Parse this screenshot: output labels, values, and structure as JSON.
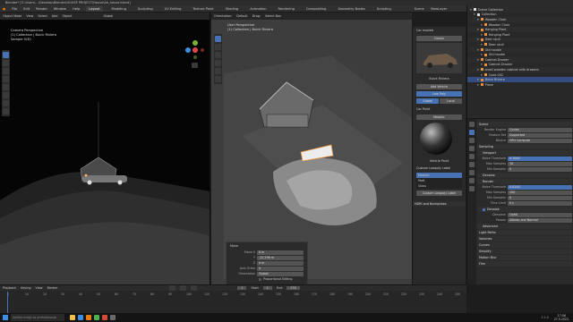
{
  "window": {
    "title": "Blender* [C:\\Users\\...\\Desktop\\Blender\\HOUSE PROJECT\\House\\Ab_house.blend]"
  },
  "menu": {
    "items": [
      "File",
      "Edit",
      "Render",
      "Window",
      "Help"
    ],
    "workspaces": [
      "Layout",
      "Modeling",
      "Sculpting",
      "UV Editing",
      "Texture Paint",
      "Shading",
      "Animation",
      "Rendering",
      "Compositing",
      "Geometry Nodes",
      "Scripting"
    ],
    "active_workspace": "Layout",
    "scene": "Scene",
    "view_layer": "ViewLayer"
  },
  "left_viewport": {
    "header": [
      "Object Mode",
      "View",
      "Select",
      "Add",
      "Object",
      "Global"
    ],
    "overlay_lines": [
      "Camera Perspective",
      "(1) Collection | Buick Riviera",
      "Sample 0/30"
    ]
  },
  "center_viewport": {
    "header": [
      "Orientation:",
      "Default",
      "Drag:",
      "Select Box"
    ],
    "overlay_lines": [
      "User Perspective",
      "(1) Collection | Buick Riviera"
    ]
  },
  "asset_panel": {
    "heading": "Car models",
    "category": "Classic",
    "asset_name": "Buick Riviera",
    "buttons": [
      "Add Vehicle",
      "Low Poly",
      "Car Paint",
      "Custom Lowpoly Label"
    ],
    "toggles": [
      "Global",
      "Local"
    ],
    "paint_label": "Metallic",
    "material_name": "Vehicle Paint",
    "list_header": "Custom Lowpoly Label",
    "list_items": [
      "Metallic",
      "Matt",
      "Gloss"
    ],
    "section": "HDRI and Backplates"
  },
  "redo_panel": {
    "title": "Move",
    "rows": [
      {
        "label": "Move X",
        "value": "0 m"
      },
      {
        "label": "Y",
        "value": "-12.296 m"
      },
      {
        "label": "Z",
        "value": "0 m"
      },
      {
        "label": "Axis Ortho",
        "value": "X"
      },
      {
        "label": "Orientation",
        "value": "Global"
      }
    ],
    "checkbox_label": "Proportional Editing"
  },
  "outliner": {
    "title": "Scene Collection",
    "items": [
      {
        "label": "Scene Collection",
        "indent": 0,
        "type": "collection"
      },
      {
        "label": "Collection",
        "indent": 1,
        "type": "collection"
      },
      {
        "label": "Wooden Chair",
        "indent": 2,
        "type": "object"
      },
      {
        "label": "Wooden Chair",
        "indent": 3,
        "type": "object"
      },
      {
        "label": "Hanging Plant",
        "indent": 2,
        "type": "object"
      },
      {
        "label": "Hanging Plant",
        "indent": 3,
        "type": "object"
      },
      {
        "label": "Deer skull",
        "indent": 2,
        "type": "object"
      },
      {
        "label": "Deer skull",
        "indent": 3,
        "type": "object"
      },
      {
        "label": "Old handle",
        "indent": 2,
        "type": "object"
      },
      {
        "label": "Old handle",
        "indent": 3,
        "type": "object"
      },
      {
        "label": "Cabinet Drawer",
        "indent": 2,
        "type": "object"
      },
      {
        "label": "Cabinet Drawer",
        "indent": 3,
        "type": "object"
      },
      {
        "label": "small wooden cabinet with drawers",
        "indent": 2,
        "type": "object"
      },
      {
        "label": "Cube.002",
        "indent": 3,
        "type": "object"
      },
      {
        "label": "Buick Riviera",
        "indent": 2,
        "type": "object",
        "selected": true
      },
      {
        "label": "Plane",
        "indent": 2,
        "type": "object"
      }
    ]
  },
  "properties": {
    "scene_label": "Scene",
    "render_engine": {
      "label": "Render Engine",
      "value": "Cycles"
    },
    "feature_set": {
      "label": "Feature Set",
      "value": "Supported"
    },
    "device": {
      "label": "Device",
      "value": "GPU Compute"
    },
    "sampling": "Sampling",
    "viewport": "Viewport",
    "vp_noise": {
      "label": "Noise Threshold",
      "value": "0.1000"
    },
    "vp_max": {
      "label": "Max Samples",
      "value": "30"
    },
    "vp_min": {
      "label": "Min Samples",
      "value": "0"
    },
    "denoise": "Denoise",
    "render": "Render",
    "r_noise": {
      "label": "Noise Threshold",
      "value": "0.0100"
    },
    "r_max": {
      "label": "Max Samples",
      "value": "200"
    },
    "r_min": {
      "label": "Min Samples",
      "value": "0"
    },
    "time_limit": {
      "label": "Time Limit",
      "value": "0 s"
    },
    "denoise2": "Denoise",
    "denoiser": {
      "label": "Denoiser",
      "value": "OptiX"
    },
    "passes": {
      "label": "Passes",
      "value": "Albedo and Normal"
    },
    "advanced": "Advanced",
    "sections": [
      "Light Paths",
      "Volumes",
      "Curves",
      "Simplify",
      "Motion Blur",
      "Film"
    ]
  },
  "timeline": {
    "header": [
      "Playback",
      "Keying",
      "View",
      "Marker"
    ],
    "frame_numbers": [
      "0",
      "10",
      "20",
      "30",
      "40",
      "50",
      "60",
      "70",
      "80",
      "90",
      "100",
      "110",
      "120",
      "130",
      "140",
      "150",
      "160",
      "170",
      "180",
      "190",
      "200",
      "210",
      "220",
      "230",
      "240",
      "250"
    ],
    "start_label": "Start",
    "start": "1",
    "end_label": "End",
    "end": "250",
    "current": "1"
  },
  "statusbar": {
    "search_placeholder": "Upišite ovdje za pretraživanje",
    "version": "3.1.0",
    "time": "17:06",
    "date": "27.5.2022."
  },
  "colors": {
    "accent": "#4772b3",
    "object": "#e8913d",
    "panel": "#2b2b2b"
  }
}
